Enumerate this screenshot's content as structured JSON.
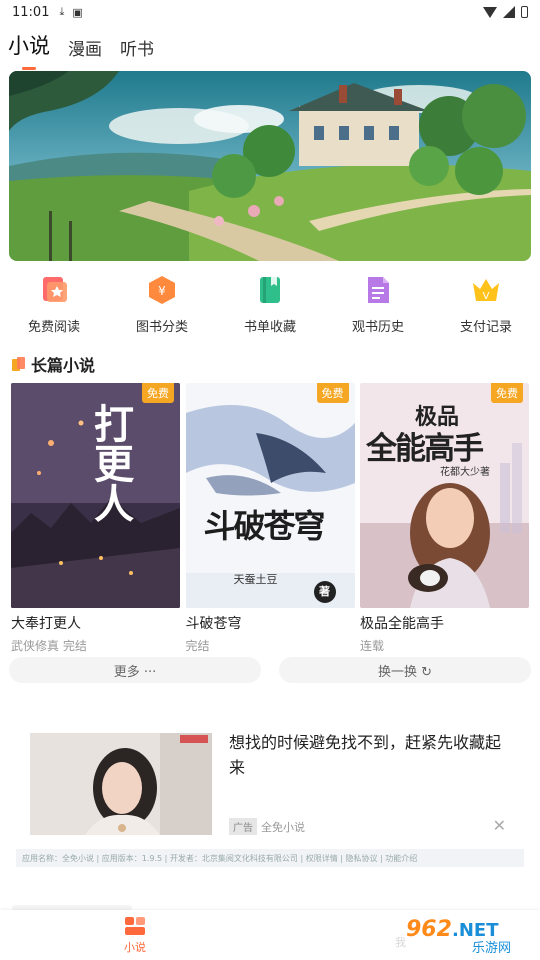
{
  "status_bar": {
    "time": "11:01"
  },
  "tabs": [
    {
      "label": "小说",
      "active": true
    },
    {
      "label": "漫画",
      "active": false
    },
    {
      "label": "听书",
      "active": false
    }
  ],
  "quick_menu": [
    {
      "label": "免费阅读",
      "icon": "free-read-icon"
    },
    {
      "label": "图书分类",
      "icon": "category-icon"
    },
    {
      "label": "书单收藏",
      "icon": "booklist-icon"
    },
    {
      "label": "观书历史",
      "icon": "history-icon"
    },
    {
      "label": "支付记录",
      "icon": "payment-icon"
    }
  ],
  "section": {
    "title": "长篇小说"
  },
  "books": [
    {
      "name": "大奉打更人",
      "meta": "武侠修真 完结",
      "badge": "免费",
      "cover_text": "打更人"
    },
    {
      "name": "斗破苍穹",
      "meta": "完结",
      "badge": "免费",
      "cover_text": "斗破苍穹",
      "cover_sub": "天蚕土豆",
      "cover_sub2": "著"
    },
    {
      "name": "极品全能高手",
      "meta": "连载",
      "badge": "免费",
      "cover_text_top": "极品",
      "cover_text": "全能高手",
      "cover_sub": "花都大少著"
    }
  ],
  "actions": {
    "more": "更多 ···",
    "refresh": "换一换 ↻"
  },
  "ad": {
    "text": "想找的时候避免找不到，赶紧先收藏起来",
    "tag": "广告",
    "source": "全免小说",
    "footer": "应用名称：全免小说 | 应用版本：1.9.5 | 开发者：北京集阅文化科技有限公司 | 权限详情 | 隐私协议 | 功能介绍"
  },
  "bottom_nav": {
    "home_label": "小说",
    "second_label": "我"
  },
  "watermark": {
    "brand": "962.NET",
    "sub": "乐游网"
  },
  "colors": {
    "accent": "#ff6a3d",
    "badge": "#f5a623"
  }
}
